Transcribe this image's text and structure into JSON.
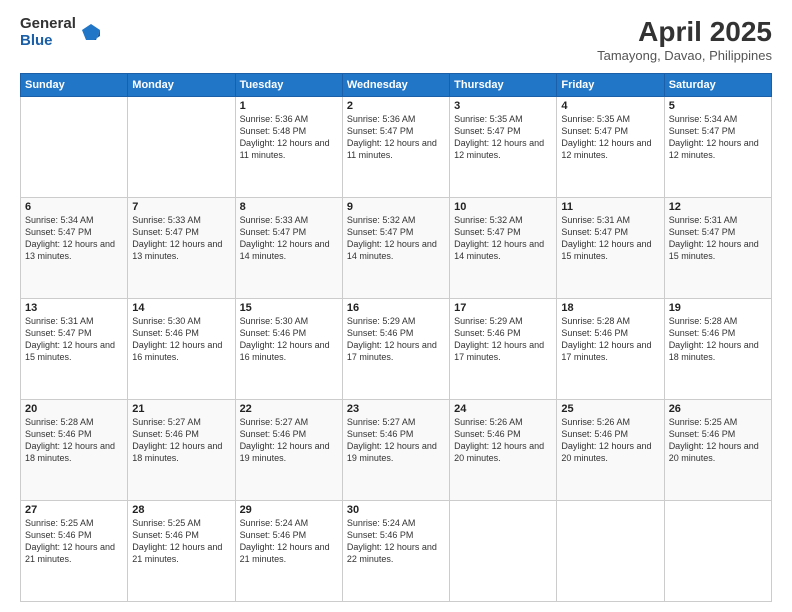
{
  "header": {
    "logo_general": "General",
    "logo_blue": "Blue",
    "month_year": "April 2025",
    "location": "Tamayong, Davao, Philippines"
  },
  "weekdays": [
    "Sunday",
    "Monday",
    "Tuesday",
    "Wednesday",
    "Thursday",
    "Friday",
    "Saturday"
  ],
  "weeks": [
    [
      {
        "day": "",
        "info": ""
      },
      {
        "day": "",
        "info": ""
      },
      {
        "day": "1",
        "info": "Sunrise: 5:36 AM\nSunset: 5:48 PM\nDaylight: 12 hours and 11 minutes."
      },
      {
        "day": "2",
        "info": "Sunrise: 5:36 AM\nSunset: 5:47 PM\nDaylight: 12 hours and 11 minutes."
      },
      {
        "day": "3",
        "info": "Sunrise: 5:35 AM\nSunset: 5:47 PM\nDaylight: 12 hours and 12 minutes."
      },
      {
        "day": "4",
        "info": "Sunrise: 5:35 AM\nSunset: 5:47 PM\nDaylight: 12 hours and 12 minutes."
      },
      {
        "day": "5",
        "info": "Sunrise: 5:34 AM\nSunset: 5:47 PM\nDaylight: 12 hours and 12 minutes."
      }
    ],
    [
      {
        "day": "6",
        "info": "Sunrise: 5:34 AM\nSunset: 5:47 PM\nDaylight: 12 hours and 13 minutes."
      },
      {
        "day": "7",
        "info": "Sunrise: 5:33 AM\nSunset: 5:47 PM\nDaylight: 12 hours and 13 minutes."
      },
      {
        "day": "8",
        "info": "Sunrise: 5:33 AM\nSunset: 5:47 PM\nDaylight: 12 hours and 14 minutes."
      },
      {
        "day": "9",
        "info": "Sunrise: 5:32 AM\nSunset: 5:47 PM\nDaylight: 12 hours and 14 minutes."
      },
      {
        "day": "10",
        "info": "Sunrise: 5:32 AM\nSunset: 5:47 PM\nDaylight: 12 hours and 14 minutes."
      },
      {
        "day": "11",
        "info": "Sunrise: 5:31 AM\nSunset: 5:47 PM\nDaylight: 12 hours and 15 minutes."
      },
      {
        "day": "12",
        "info": "Sunrise: 5:31 AM\nSunset: 5:47 PM\nDaylight: 12 hours and 15 minutes."
      }
    ],
    [
      {
        "day": "13",
        "info": "Sunrise: 5:31 AM\nSunset: 5:47 PM\nDaylight: 12 hours and 15 minutes."
      },
      {
        "day": "14",
        "info": "Sunrise: 5:30 AM\nSunset: 5:46 PM\nDaylight: 12 hours and 16 minutes."
      },
      {
        "day": "15",
        "info": "Sunrise: 5:30 AM\nSunset: 5:46 PM\nDaylight: 12 hours and 16 minutes."
      },
      {
        "day": "16",
        "info": "Sunrise: 5:29 AM\nSunset: 5:46 PM\nDaylight: 12 hours and 17 minutes."
      },
      {
        "day": "17",
        "info": "Sunrise: 5:29 AM\nSunset: 5:46 PM\nDaylight: 12 hours and 17 minutes."
      },
      {
        "day": "18",
        "info": "Sunrise: 5:28 AM\nSunset: 5:46 PM\nDaylight: 12 hours and 17 minutes."
      },
      {
        "day": "19",
        "info": "Sunrise: 5:28 AM\nSunset: 5:46 PM\nDaylight: 12 hours and 18 minutes."
      }
    ],
    [
      {
        "day": "20",
        "info": "Sunrise: 5:28 AM\nSunset: 5:46 PM\nDaylight: 12 hours and 18 minutes."
      },
      {
        "day": "21",
        "info": "Sunrise: 5:27 AM\nSunset: 5:46 PM\nDaylight: 12 hours and 18 minutes."
      },
      {
        "day": "22",
        "info": "Sunrise: 5:27 AM\nSunset: 5:46 PM\nDaylight: 12 hours and 19 minutes."
      },
      {
        "day": "23",
        "info": "Sunrise: 5:27 AM\nSunset: 5:46 PM\nDaylight: 12 hours and 19 minutes."
      },
      {
        "day": "24",
        "info": "Sunrise: 5:26 AM\nSunset: 5:46 PM\nDaylight: 12 hours and 20 minutes."
      },
      {
        "day": "25",
        "info": "Sunrise: 5:26 AM\nSunset: 5:46 PM\nDaylight: 12 hours and 20 minutes."
      },
      {
        "day": "26",
        "info": "Sunrise: 5:25 AM\nSunset: 5:46 PM\nDaylight: 12 hours and 20 minutes."
      }
    ],
    [
      {
        "day": "27",
        "info": "Sunrise: 5:25 AM\nSunset: 5:46 PM\nDaylight: 12 hours and 21 minutes."
      },
      {
        "day": "28",
        "info": "Sunrise: 5:25 AM\nSunset: 5:46 PM\nDaylight: 12 hours and 21 minutes."
      },
      {
        "day": "29",
        "info": "Sunrise: 5:24 AM\nSunset: 5:46 PM\nDaylight: 12 hours and 21 minutes."
      },
      {
        "day": "30",
        "info": "Sunrise: 5:24 AM\nSunset: 5:46 PM\nDaylight: 12 hours and 22 minutes."
      },
      {
        "day": "",
        "info": ""
      },
      {
        "day": "",
        "info": ""
      },
      {
        "day": "",
        "info": ""
      }
    ]
  ]
}
